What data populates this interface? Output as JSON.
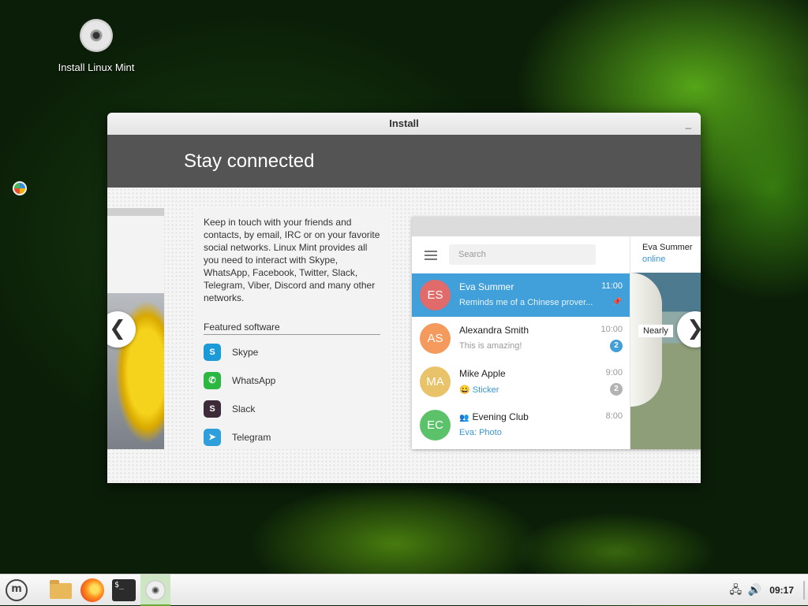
{
  "desktop": {
    "icon_label": "Install Linux Mint"
  },
  "window": {
    "title": "Install",
    "minimize_glyph": "_"
  },
  "header": {
    "title": "Stay connected"
  },
  "slide": {
    "description": "Keep in touch with your friends and contacts, by email, IRC or on your favorite social networks. Linux Mint provides all you need to interact with Skype, WhatsApp, Facebook, Twitter, Slack, Telegram, Viber, Discord and many other networks.",
    "featured_title": "Featured software",
    "apps": [
      {
        "name": "Skype",
        "icon": "skype-icon",
        "color": "#1a9bd7",
        "glyph": "S"
      },
      {
        "name": "WhatsApp",
        "icon": "whatsapp-icon",
        "color": "#2bb741",
        "glyph": "✆"
      },
      {
        "name": "Slack",
        "icon": "slack-icon",
        "color": "#3d2b3a",
        "glyph": "S"
      },
      {
        "name": "Telegram",
        "icon": "telegram-icon",
        "color": "#2f9fdc",
        "glyph": "➤"
      }
    ],
    "prev_arrow": "❮",
    "next_arrow": "❯"
  },
  "telegram": {
    "search_placeholder": "Search",
    "chats": [
      {
        "initials": "ES",
        "name": "Eva Summer",
        "time": "11:00",
        "message": "Reminds me of a Chinese prover...",
        "color": "#e16a6a",
        "active": true,
        "pin": "📌"
      },
      {
        "initials": "AS",
        "name": "Alexandra Smith",
        "time": "10:00",
        "message": "This is amazing!",
        "color": "#f49a5d",
        "badge": "2",
        "badge_color": "#419fd9"
      },
      {
        "initials": "MA",
        "name": "Mike Apple",
        "time": "9:00",
        "message": "😀 Sticker",
        "color": "#e8c36a",
        "badge": "2",
        "badge_color": "#b3b3b3"
      },
      {
        "initials": "EC",
        "name": "Evening Club",
        "name_prefix": "👥",
        "time": "8:00",
        "message": "Eva: Photo",
        "color": "#5cc26a"
      }
    ],
    "pane": {
      "name": "Eva Summer",
      "status": "online",
      "caption": "Nearly"
    }
  },
  "taskbar": {
    "menu_glyph": "m",
    "terminal_glyph": "$_",
    "clock": "09:17",
    "network_glyph": "🖧",
    "volume_glyph": "🔊"
  }
}
